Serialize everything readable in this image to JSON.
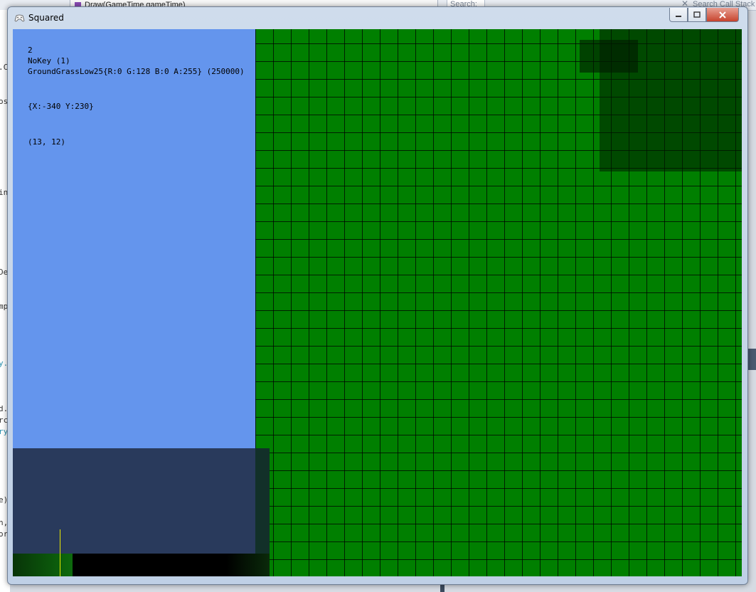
{
  "ide": {
    "tab_label": "Draw(GameTime gameTime)",
    "search_placeholder": "Search:",
    "call_stack_search": "Search Call Stack",
    "left_fragments": [
      ".C",
      "os",
      "in",
      "De",
      "mp",
      "y.",
      "d.",
      "rc",
      "ry",
      "e)",
      "n,",
      "or"
    ]
  },
  "window": {
    "title": "Squared",
    "title_icon": "gamepad-icon",
    "minimize_icon": "minimize-icon",
    "maximize_icon": "maximize-icon",
    "close_icon": "close-icon"
  },
  "debug": {
    "line1": "2",
    "line2": "NoKey (1)",
    "line3": "GroundGrassLow25{R:0 G:128 B:0 A:255} (250000)",
    "position": "{X:-340 Y:230}",
    "tile": "(13, 12)"
  },
  "colors": {
    "panel_blue": "#6495ed",
    "grass_green": "#007f00",
    "bottom_panel": "#293a5c",
    "cursor_yellow": "#e8e800"
  }
}
